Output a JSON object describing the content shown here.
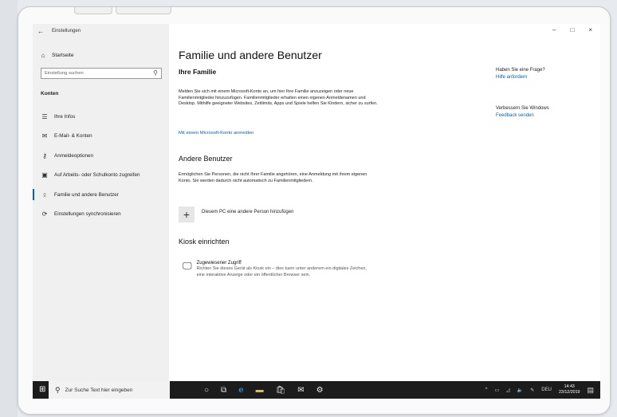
{
  "window": {
    "title": "Einstellungen",
    "back_icon": "arrow-left-icon",
    "controls": {
      "minimize": "–",
      "maximize": "□",
      "close": "×"
    }
  },
  "sidebar": {
    "home_label": "Startseite",
    "search_placeholder": "Einstellung suchen",
    "section_title": "Konten",
    "items": [
      {
        "label": "Ihre Infos",
        "icon": "person-card-icon"
      },
      {
        "label": "E-Mail- & Konten",
        "icon": "mail-icon"
      },
      {
        "label": "Anmeldeoptionen",
        "icon": "key-icon"
      },
      {
        "label": "Auf Arbeits- oder Schulkonto zugreifen",
        "icon": "briefcase-icon"
      },
      {
        "label": "Familie und andere Benutzer",
        "icon": "person-add-icon",
        "active": true
      },
      {
        "label": "Einstellungen synchronisieren",
        "icon": "sync-icon"
      }
    ]
  },
  "main": {
    "title": "Familie und andere Benutzer",
    "family": {
      "heading": "Ihre Familie",
      "text": "Melden Sie sich mit einem Microsoft-Konto an, um hier Ihre Familie anzuzeigen oder neue Familienmitglieder hinzuzufügen. Familienmitglieder erhalten einen eigenen Anmeldenamen und Desktop. Mithilfe geeigneter Websites, Zeitlimits, Apps und Spiele helfen Sie Kindern, sicher zu surfen.",
      "link": "Mit einem Microsoft-Konto anmelden"
    },
    "others": {
      "heading": "Andere Benutzer",
      "text": "Ermöglichen Sie Personen, die nicht Ihrer Familie angehören, eine Anmeldung mit ihrem eigenen Konto. Sie werden dadurch nicht automatisch zu Familienmitgliedern.",
      "add_label": "Diesem PC eine andere Person hinzufügen"
    },
    "kiosk": {
      "heading": "Kiosk einrichten",
      "item_title": "Zugewiesener Zugriff",
      "item_text": "Richten Sie dieses Gerät als Kiosk ein – dies kann unter anderem ein digitales Zeichen, eine interaktive Anzeige oder ein öffentlicher Browser sein."
    }
  },
  "aside": {
    "question": "Haben Sie eine Frage?",
    "help_link": "Hilfe anfordern",
    "improve": "Verbessern Sie Windows",
    "feedback_link": "Feedback senden"
  },
  "taskbar": {
    "search_placeholder": "Zur Suche Text hier eingeben",
    "language": "DEU",
    "time": "14:43",
    "date": "23/12/2019"
  },
  "colors": {
    "accent": "#0063b1",
    "taskbar": "#1c1c1c",
    "sidebar": "#f0f0f0"
  }
}
